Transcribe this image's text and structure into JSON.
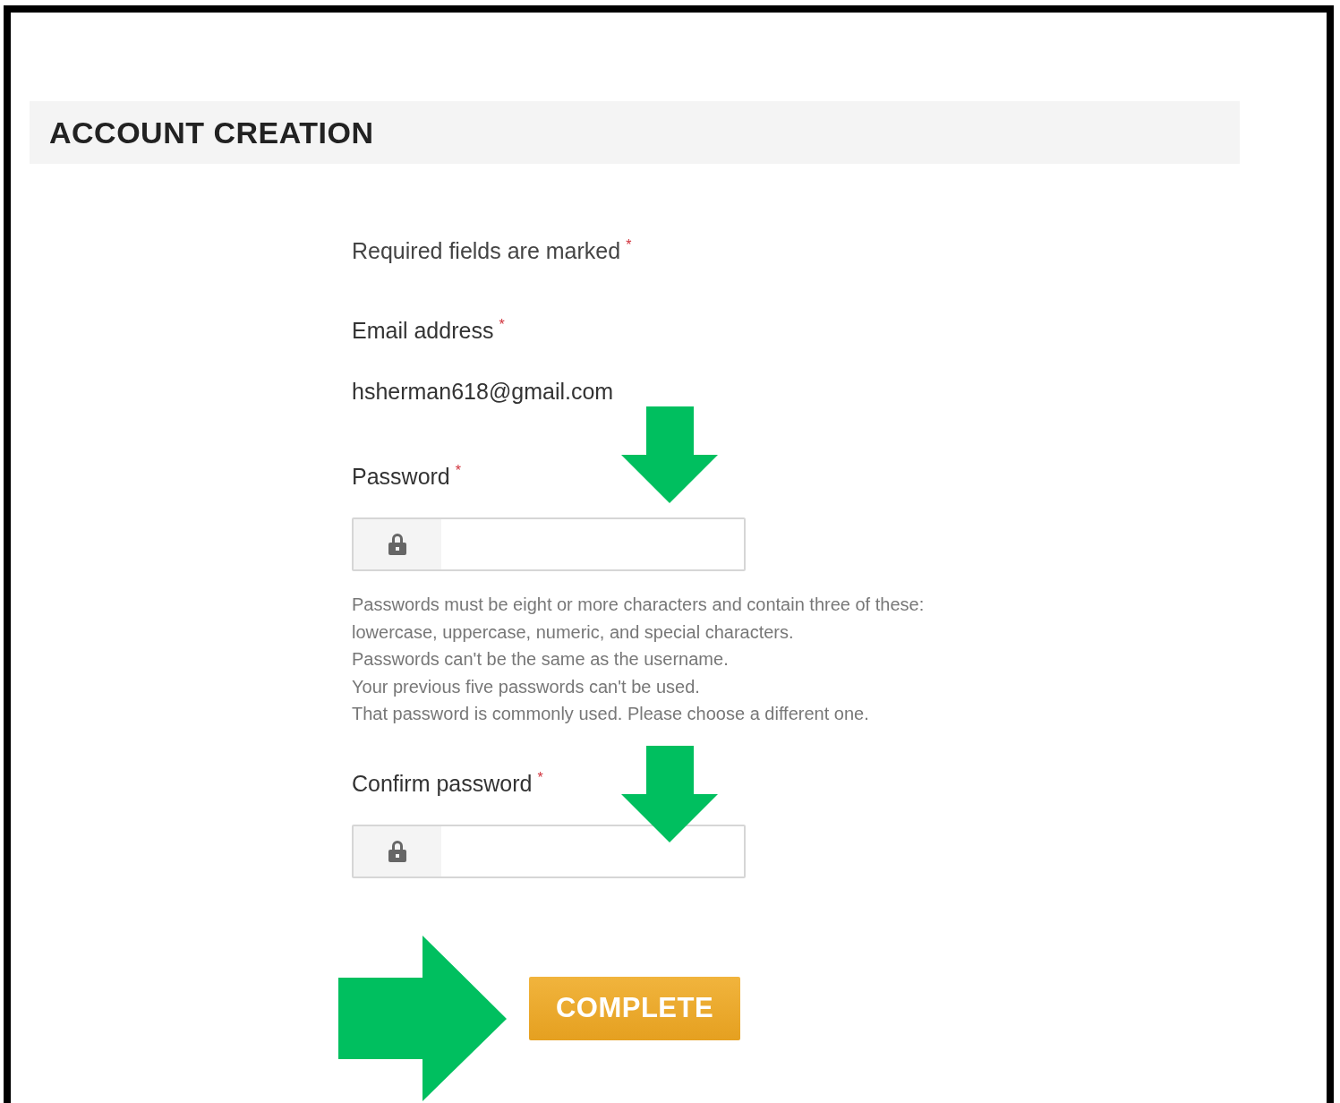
{
  "header": {
    "title": "ACCOUNT CREATION"
  },
  "form": {
    "required_note": {
      "text": "Required fields are marked",
      "mark": "*"
    },
    "fields": [
      {
        "kind": "static",
        "label": "Email address",
        "mark": "*",
        "value": "hsherman618@gmail.com"
      },
      {
        "kind": "password",
        "label": "Password",
        "mark": "*",
        "help": [
          "Passwords must be eight or more characters and contain three of these: lowercase, uppercase, numeric, and special characters.",
          "Passwords can't be the same as the username.",
          "Your previous five passwords can't be used.",
          "That password is commonly used. Please choose a different one."
        ]
      },
      {
        "kind": "password",
        "label": "Confirm password",
        "mark": "*"
      }
    ],
    "submit": "COMPLETE"
  }
}
